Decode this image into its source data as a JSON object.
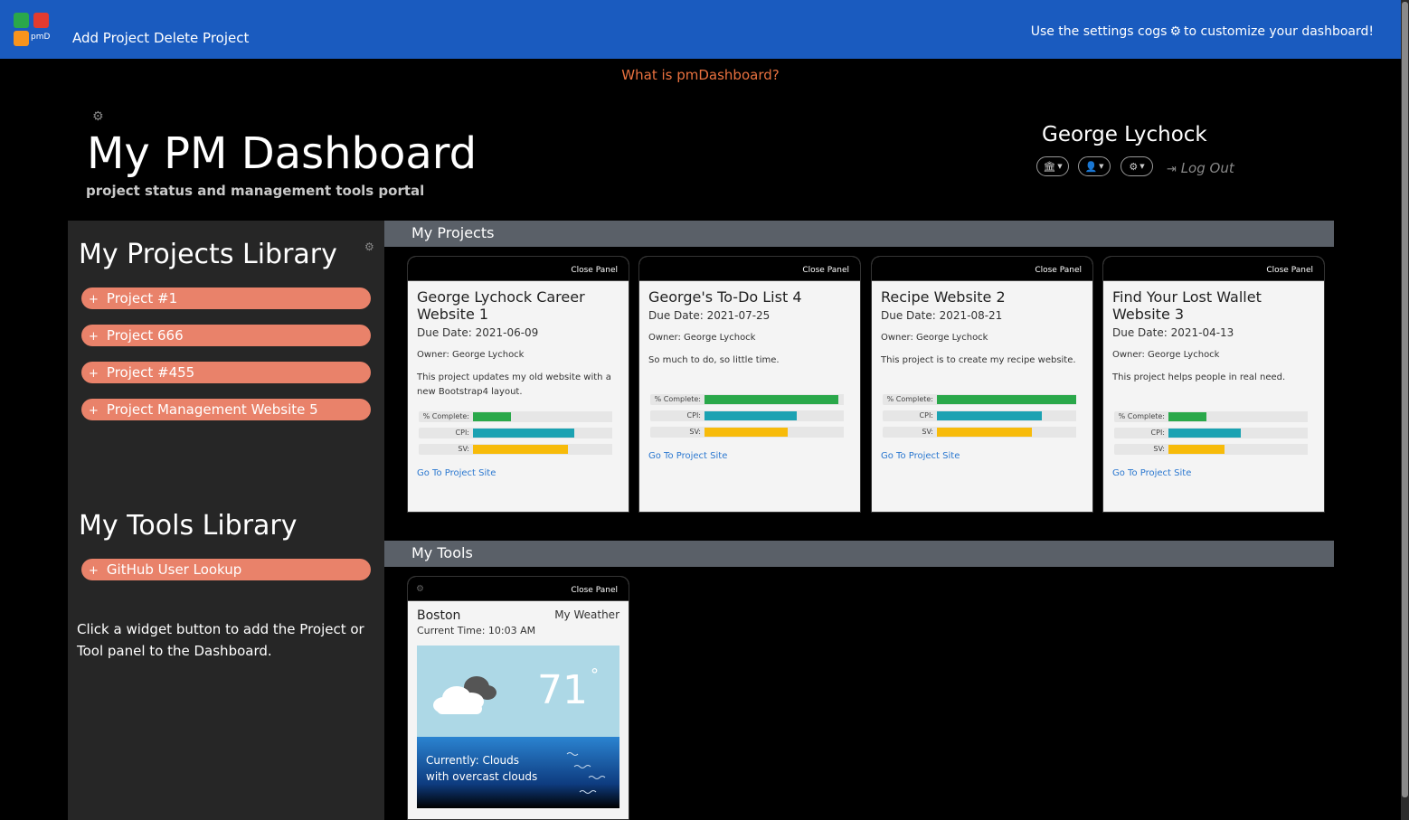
{
  "nav": {
    "logo_text": "pmD",
    "add_project": "Add Project",
    "delete_project": "Delete Project",
    "hint_prefix": "Use the settings cogs",
    "hint_suffix": "to customize your dashboard!"
  },
  "what_is": "What is pmDashboard?",
  "header": {
    "title": "My PM Dashboard",
    "subtitle": "project status and management tools portal"
  },
  "user": {
    "name": "George Lychock",
    "logout": "Log Out"
  },
  "left": {
    "projects_heading": "My Projects Library",
    "projects": [
      "Project #1",
      "Project 666",
      "Project #455",
      "Project Management Website 5"
    ],
    "tools_heading": "My Tools Library",
    "tools": [
      "GitHub User Lookup"
    ],
    "hint": "Click a widget button to add the Project or Tool panel to the Dashboard."
  },
  "sections": {
    "projects": "My Projects",
    "tools": "My Tools"
  },
  "card_common": {
    "close": "Close Panel",
    "bar_complete": "% Complete:",
    "bar_cpi": "CPI:",
    "bar_sv": "SV:",
    "link": "Go To Project Site"
  },
  "colors": {
    "complete": "#2aa84a",
    "cpi": "#1ba2b2",
    "sv": "#f7bb0a"
  },
  "projects": [
    {
      "title": "George Lychock Career Website 1",
      "due": "Due Date: 2021-06-09",
      "owner": "Owner: George Lychock",
      "desc": "This project updates my old website with a new Bootstrap4 layout.",
      "complete": 0.27,
      "cpi": 0.73,
      "sv": 0.68
    },
    {
      "title": "George's To-Do List 4",
      "due": "Due Date: 2021-07-25",
      "owner": "Owner: George Lychock",
      "desc": "So much to do, so little time.",
      "complete": 0.96,
      "cpi": 0.66,
      "sv": 0.6
    },
    {
      "title": "Recipe Website 2",
      "due": "Due Date: 2021-08-21",
      "owner": "Owner: George Lychock",
      "desc": "This project is to create my recipe website.",
      "complete": 1.0,
      "cpi": 0.75,
      "sv": 0.68
    },
    {
      "title": "Find Your Lost Wallet Website 3",
      "due": "Due Date: 2021-04-13",
      "owner": "Owner: George Lychock",
      "desc": "This project helps people in real need.",
      "complete": 0.27,
      "cpi": 0.52,
      "sv": 0.4
    }
  ],
  "weather": {
    "city": "Boston",
    "label": "My Weather",
    "time": "Current Time: 10:03 AM",
    "temp": "71",
    "deg": "°",
    "currently_line1": "Currently: Clouds",
    "currently_line2": "with overcast clouds"
  }
}
